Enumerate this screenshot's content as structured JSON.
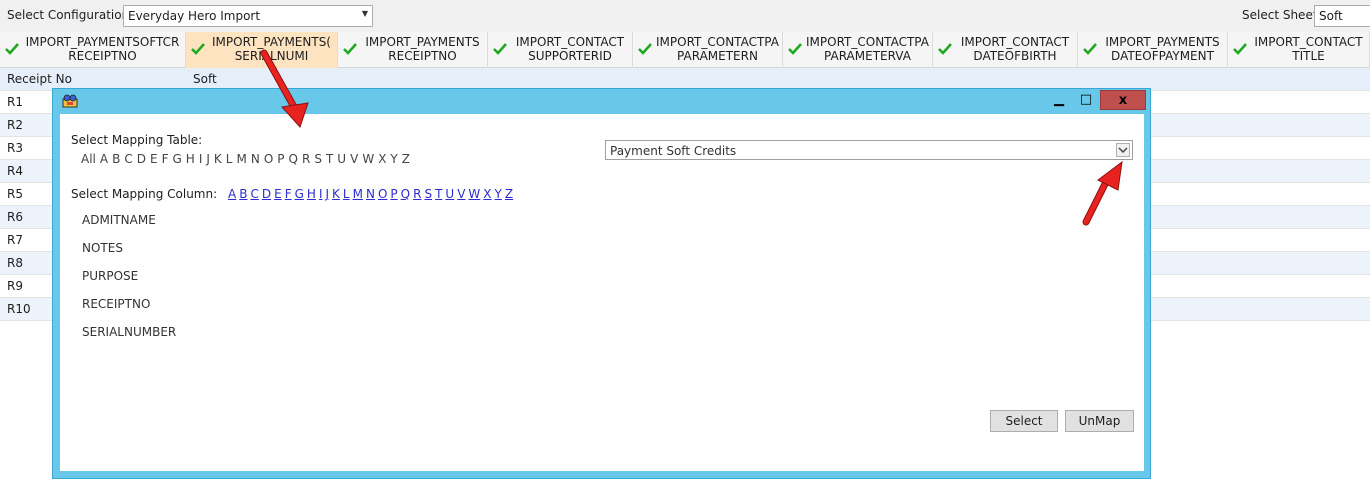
{
  "toolbar": {
    "config_label": "Select Configuration",
    "config_value": "Everyday Hero Import",
    "sheet_label": "Select Sheet",
    "sheet_value": "Soft"
  },
  "grid": {
    "columns": [
      {
        "line1": "IMPORT_PAYMENTSOFTCR",
        "line2": "RECEIPTNO"
      },
      {
        "line1": "IMPORT_PAYMENTS(",
        "line2": "SERIALNUMI"
      },
      {
        "line1": "IMPORT_PAYMENTS",
        "line2": "RECEIPTNO"
      },
      {
        "line1": "IMPORT_CONTACT",
        "line2": "SUPPORTERID"
      },
      {
        "line1": "IMPORT_CONTACTPA",
        "line2": "PARAMETERN"
      },
      {
        "line1": "IMPORT_CONTACTPA",
        "line2": "PARAMETERVA"
      },
      {
        "line1": "IMPORT_CONTACT",
        "line2": "DATEOFBIRTH"
      },
      {
        "line1": "IMPORT_PAYMENTS",
        "line2": "DATEOFPAYMENT"
      },
      {
        "line1": "IMPORT_CONTACT",
        "line2": "TITLE"
      }
    ],
    "first_row": [
      "Receipt No",
      "Soft"
    ],
    "rows": [
      "R1",
      "R2",
      "R3",
      "R4",
      "R5",
      "R6",
      "R7",
      "R8",
      "R9",
      "R10"
    ]
  },
  "dialog": {
    "minimize": "▁",
    "maximize": "□",
    "close": "x",
    "table_label": "Select Mapping Table:",
    "table_letters": [
      "All",
      "A",
      "B",
      "C",
      "D",
      "E",
      "F",
      "G",
      "H",
      "I",
      "J",
      "K",
      "L",
      "M",
      "N",
      "O",
      "P",
      "Q",
      "R",
      "S",
      "T",
      "U",
      "V",
      "W",
      "X",
      "Y",
      "Z"
    ],
    "table_value": "Payment Soft Credits",
    "column_label": "Select Mapping Column:",
    "column_letters": [
      "A",
      "B",
      "C",
      "D",
      "E",
      "F",
      "G",
      "H",
      "I",
      "J",
      "K",
      "L",
      "M",
      "N",
      "O",
      "P",
      "Q",
      "R",
      "S",
      "T",
      "U",
      "V",
      "W",
      "X",
      "Y",
      "Z"
    ],
    "columns": [
      "ADMITNAME",
      "NOTES",
      "PURPOSE",
      "RECEIPTNO",
      "SERIALNUMBER"
    ],
    "select_button": "Select",
    "unmap_button": "UnMap"
  },
  "colors": {
    "titlebar": "#68c8ea",
    "close": "#c0504d",
    "selected_column": "#fde3c0",
    "link": "#2c2ccf",
    "annotation_arrow": "#e8231f",
    "check": "#1ea81e"
  },
  "icons": [
    "check-icon",
    "dropdown-arrow-icon",
    "app-icon",
    "minimize-icon",
    "maximize-icon",
    "close-icon",
    "annotation-arrow"
  ]
}
